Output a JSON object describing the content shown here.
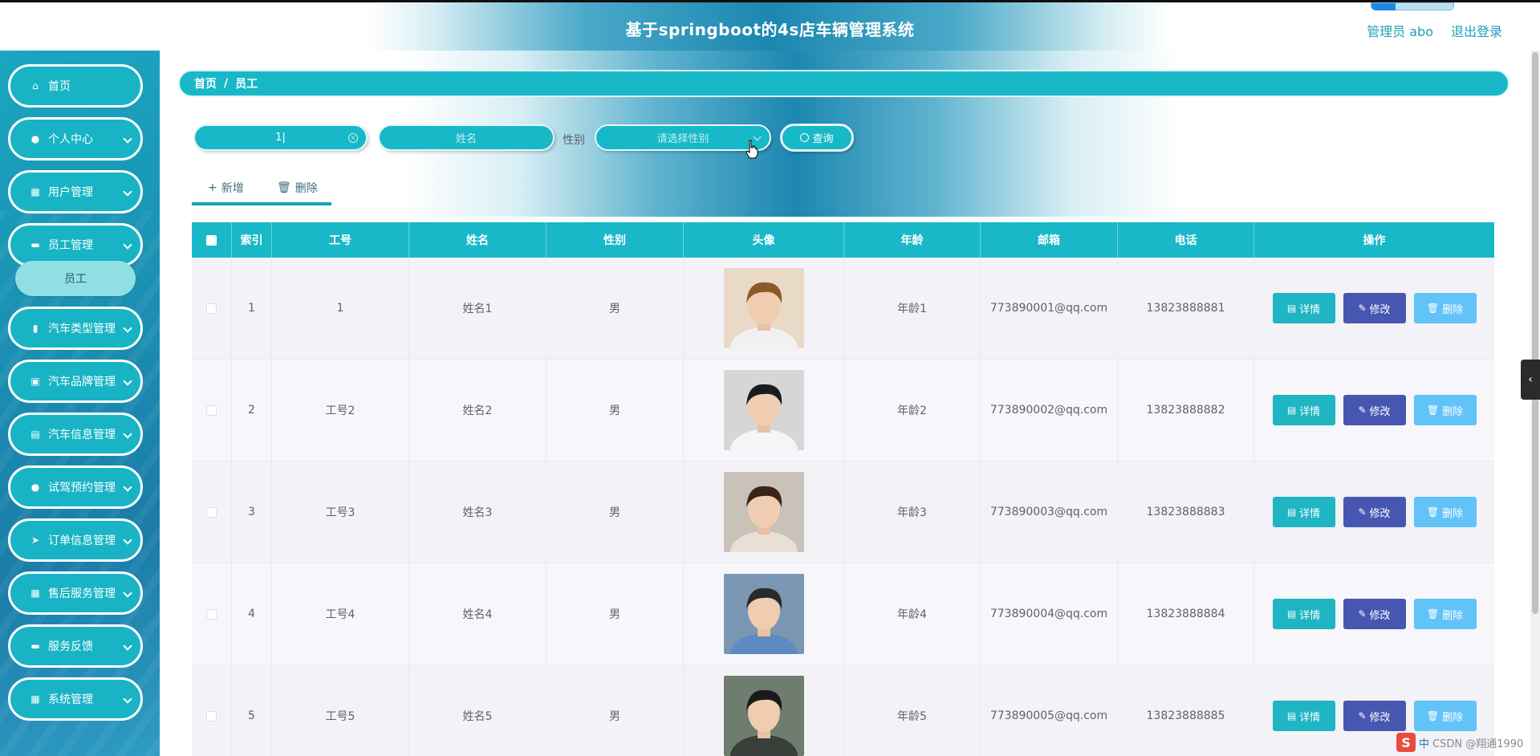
{
  "header": {
    "title": "基于springboot的4s店车辆管理系统",
    "user": "管理员 abo",
    "logout": "退出登录"
  },
  "sidebar": {
    "items": [
      {
        "label": "首页",
        "icon": "home-icon",
        "glyph": "⌂"
      },
      {
        "label": "个人中心",
        "icon": "user-icon",
        "glyph": "●"
      },
      {
        "label": "用户管理",
        "icon": "grid-icon",
        "glyph": "▦"
      },
      {
        "label": "员工管理",
        "icon": "chat-icon",
        "glyph": "▬"
      },
      {
        "label": "汽车类型管理",
        "icon": "bar-chart-icon",
        "glyph": "▮"
      },
      {
        "label": "汽车品牌管理",
        "icon": "picture-icon",
        "glyph": "▣"
      },
      {
        "label": "汽车信息管理",
        "icon": "briefcase-icon",
        "glyph": "▤"
      },
      {
        "label": "试驾预约管理",
        "icon": "bulb-icon",
        "glyph": "●"
      },
      {
        "label": "订单信息管理",
        "icon": "send-icon",
        "glyph": "➤"
      },
      {
        "label": "售后服务管理",
        "icon": "apps-icon",
        "glyph": "▦"
      },
      {
        "label": "服务反馈",
        "icon": "ticket-icon",
        "glyph": "▬"
      },
      {
        "label": "系统管理",
        "icon": "apps-icon",
        "glyph": "▦"
      }
    ],
    "sub_item": "员工"
  },
  "breadcrumb": {
    "home": "首页",
    "sep": "/",
    "current": "员工"
  },
  "search": {
    "gonghao_value": "1",
    "name_placeholder": "姓名",
    "gender_label": "性别",
    "gender_placeholder": "请选择性别",
    "query_label": "查询"
  },
  "toolbar": {
    "add_label": "新增",
    "delete_label": "删除"
  },
  "table": {
    "headers": [
      "索引",
      "工号",
      "姓名",
      "性别",
      "头像",
      "年龄",
      "邮箱",
      "电话",
      "操作"
    ],
    "rows": [
      {
        "index": "1",
        "gonghao": "1",
        "name": "姓名1",
        "gender": "男",
        "age": "年龄1",
        "email": "773890001@qq.com",
        "phone": "13823888881"
      },
      {
        "index": "2",
        "gonghao": "工号2",
        "name": "姓名2",
        "gender": "男",
        "age": "年龄2",
        "email": "773890002@qq.com",
        "phone": "13823888882"
      },
      {
        "index": "3",
        "gonghao": "工号3",
        "name": "姓名3",
        "gender": "男",
        "age": "年龄3",
        "email": "773890003@qq.com",
        "phone": "13823888883"
      },
      {
        "index": "4",
        "gonghao": "工号4",
        "name": "姓名4",
        "gender": "男",
        "age": "年龄4",
        "email": "773890004@qq.com",
        "phone": "13823888884"
      },
      {
        "index": "5",
        "gonghao": "工号5",
        "name": "姓名5",
        "gender": "男",
        "age": "年龄5",
        "email": "773890005@qq.com",
        "phone": "13823888885"
      }
    ],
    "ops": {
      "detail": "详情",
      "edit": "修改",
      "delete": "删除"
    }
  },
  "tray": {
    "logo": "S",
    "items": [
      "中",
      "CSDN @翔通1990"
    ]
  },
  "colors": {
    "accent": "#18b8c8",
    "edit_button": "#4757b1",
    "delete_button": "#61c3f7",
    "detail_button": "#1fb5c2"
  }
}
